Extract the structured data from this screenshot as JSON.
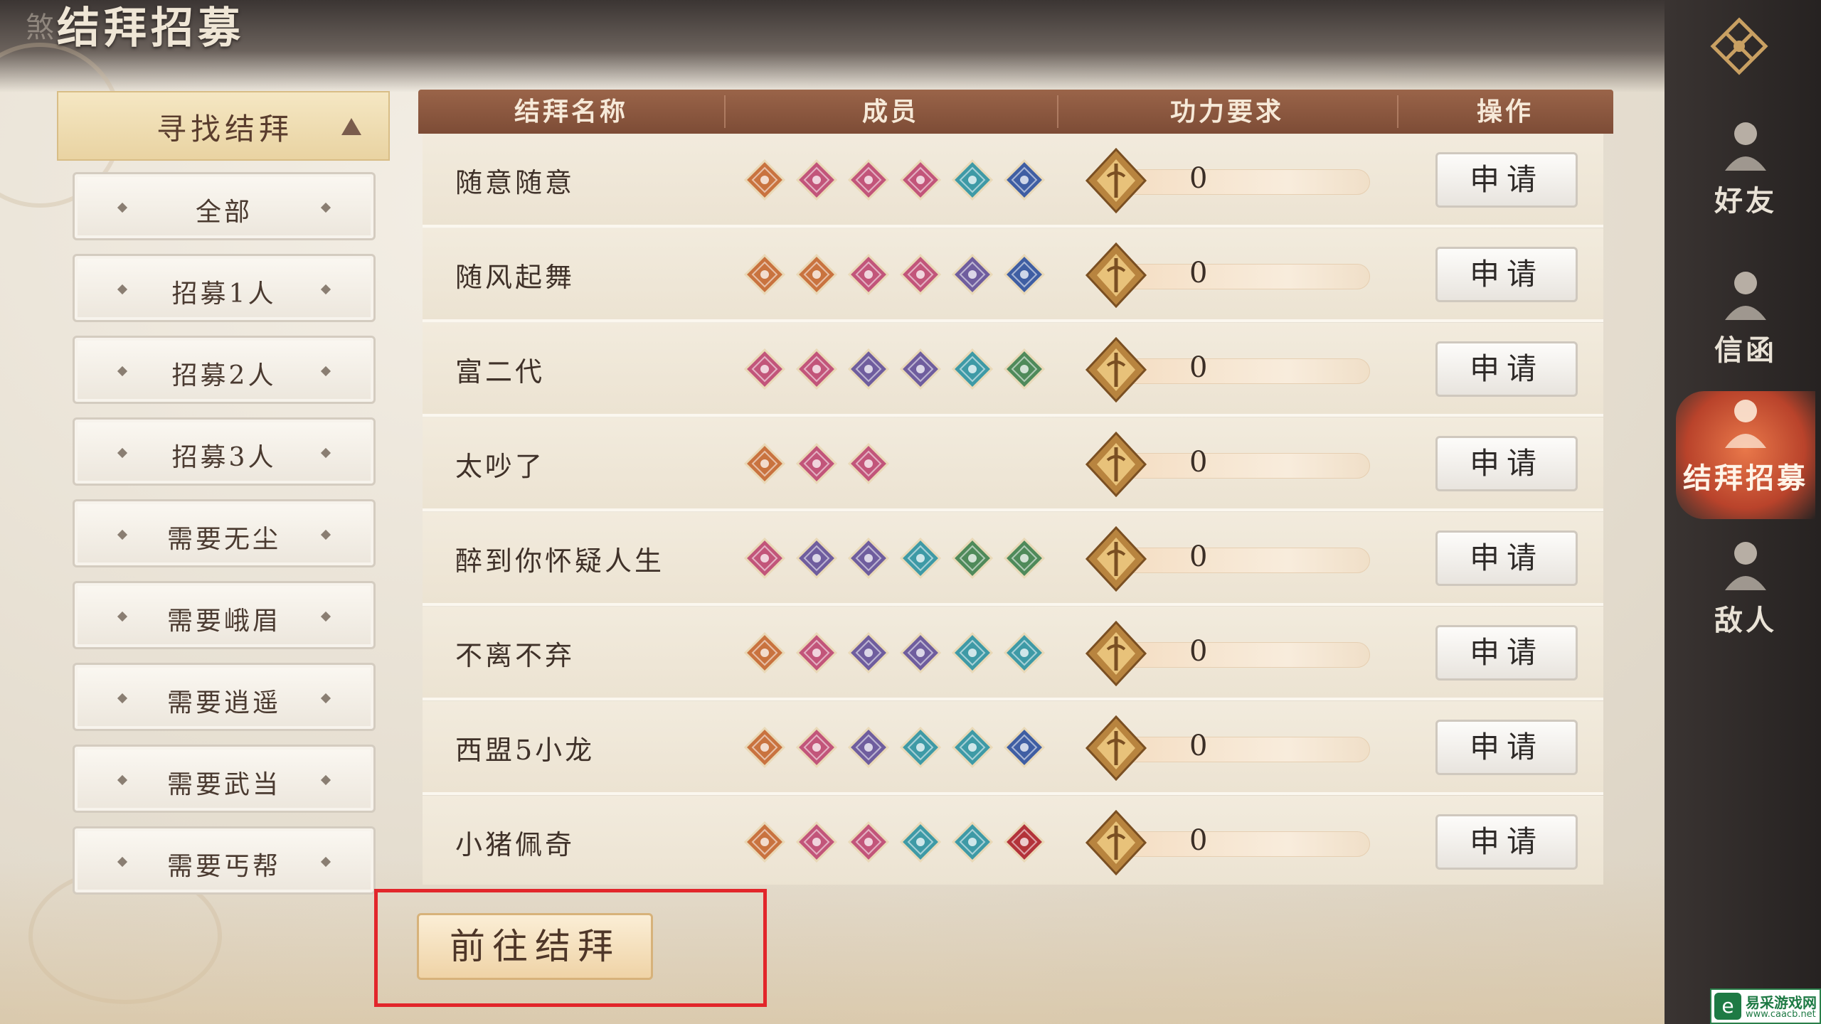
{
  "page": {
    "title_prefix": "煞",
    "title": "结拜招募"
  },
  "filter": {
    "header": "寻找结拜",
    "items": [
      "全部",
      "招募1人",
      "招募2人",
      "招募3人",
      "需要无尘",
      "需要峨眉",
      "需要逍遥",
      "需要武当",
      "需要丐帮"
    ]
  },
  "table": {
    "headers": [
      "结拜名称",
      "成员",
      "功力要求",
      "操作"
    ],
    "rows": [
      {
        "name": "随意随意",
        "members": [
          "orange",
          "pink",
          "pink",
          "pink",
          "teal",
          "blue"
        ],
        "power": "0",
        "action": "申请"
      },
      {
        "name": "随风起舞",
        "members": [
          "orange",
          "orange",
          "pink",
          "pink",
          "purple",
          "blue"
        ],
        "power": "0",
        "action": "申请"
      },
      {
        "name": "富二代",
        "members": [
          "pink",
          "pink",
          "purple",
          "purple",
          "teal",
          "green"
        ],
        "power": "0",
        "action": "申请"
      },
      {
        "name": "太吵了",
        "members": [
          "orange",
          "pink",
          "pink"
        ],
        "power": "0",
        "action": "申请"
      },
      {
        "name": "醉到你怀疑人生",
        "members": [
          "pink",
          "purple",
          "purple",
          "teal",
          "green",
          "green"
        ],
        "power": "0",
        "action": "申请"
      },
      {
        "name": "不离不弃",
        "members": [
          "orange",
          "pink",
          "purple",
          "purple",
          "teal",
          "teal"
        ],
        "power": "0",
        "action": "申请"
      },
      {
        "name": "西盟5小龙",
        "members": [
          "orange",
          "pink",
          "purple",
          "teal",
          "teal",
          "blue"
        ],
        "power": "0",
        "action": "申请"
      },
      {
        "name": "小猪佩奇",
        "members": [
          "orange",
          "pink",
          "pink",
          "teal",
          "teal",
          "red"
        ],
        "power": "0",
        "action": "申请"
      }
    ]
  },
  "go_button": "前往结拜",
  "right_nav": [
    {
      "label": "好友",
      "icon": "friends-icon",
      "active": false
    },
    {
      "label": "信函",
      "icon": "letter-icon",
      "active": false
    },
    {
      "label": "结拜招募",
      "icon": "sworn-recruit-icon",
      "active": true
    },
    {
      "label": "敌人",
      "icon": "enemy-icon",
      "active": false
    }
  ],
  "watermark": {
    "text": "易采游戏网",
    "url": "www.caacb.net",
    "logo": "e"
  },
  "colors": {
    "orange": "#c9733f",
    "pink": "#c2557a",
    "purple": "#6f5d9e",
    "teal": "#3e9aa6",
    "blue": "#3f5ea3",
    "green": "#4f8a5a",
    "red": "#b3333a",
    "accent_red": "#e2262b"
  }
}
